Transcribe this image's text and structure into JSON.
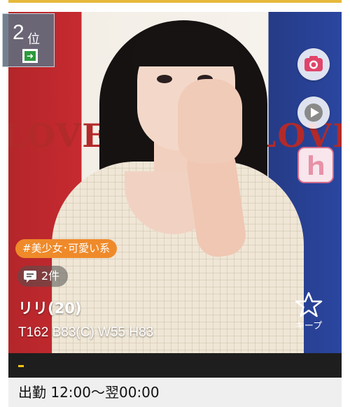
{
  "rank": {
    "number": "2",
    "suffix": "位",
    "trend_icon": "arrow-right-icon"
  },
  "photo": {
    "backdrop_text_left": "LOVE",
    "backdrop_text_right": "LOVE"
  },
  "side_icons": [
    "camera-icon",
    "play-icon",
    "h-logo-icon"
  ],
  "tag": "#美少女･可愛い系",
  "comments": {
    "icon": "comment-icon",
    "count": "2件"
  },
  "profile": {
    "name": "リリ(20)",
    "measurements": "T162 B83(C) W55 H83"
  },
  "keep": {
    "icon": "star-outline-icon",
    "label": "キープ"
  },
  "status_dash": "-",
  "schedule": "出勤 12:00～翌00:00",
  "colors": {
    "tag_orange": "#ef8a2a",
    "rank_bg": "#606e80",
    "accent_gold": "#e7b83a",
    "camera_pink": "#e0456a"
  }
}
